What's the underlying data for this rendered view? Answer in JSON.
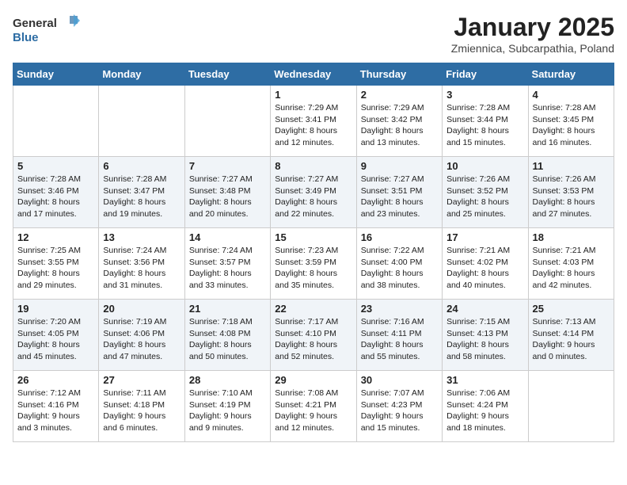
{
  "header": {
    "logo_general": "General",
    "logo_blue": "Blue",
    "main_title": "January 2025",
    "subtitle": "Zmiennica, Subcarpathia, Poland"
  },
  "days_of_week": [
    "Sunday",
    "Monday",
    "Tuesday",
    "Wednesday",
    "Thursday",
    "Friday",
    "Saturday"
  ],
  "weeks": [
    [
      {
        "day": "",
        "content": ""
      },
      {
        "day": "",
        "content": ""
      },
      {
        "day": "",
        "content": ""
      },
      {
        "day": "1",
        "content": "Sunrise: 7:29 AM\nSunset: 3:41 PM\nDaylight: 8 hours\nand 12 minutes."
      },
      {
        "day": "2",
        "content": "Sunrise: 7:29 AM\nSunset: 3:42 PM\nDaylight: 8 hours\nand 13 minutes."
      },
      {
        "day": "3",
        "content": "Sunrise: 7:28 AM\nSunset: 3:44 PM\nDaylight: 8 hours\nand 15 minutes."
      },
      {
        "day": "4",
        "content": "Sunrise: 7:28 AM\nSunset: 3:45 PM\nDaylight: 8 hours\nand 16 minutes."
      }
    ],
    [
      {
        "day": "5",
        "content": "Sunrise: 7:28 AM\nSunset: 3:46 PM\nDaylight: 8 hours\nand 17 minutes."
      },
      {
        "day": "6",
        "content": "Sunrise: 7:28 AM\nSunset: 3:47 PM\nDaylight: 8 hours\nand 19 minutes."
      },
      {
        "day": "7",
        "content": "Sunrise: 7:27 AM\nSunset: 3:48 PM\nDaylight: 8 hours\nand 20 minutes."
      },
      {
        "day": "8",
        "content": "Sunrise: 7:27 AM\nSunset: 3:49 PM\nDaylight: 8 hours\nand 22 minutes."
      },
      {
        "day": "9",
        "content": "Sunrise: 7:27 AM\nSunset: 3:51 PM\nDaylight: 8 hours\nand 23 minutes."
      },
      {
        "day": "10",
        "content": "Sunrise: 7:26 AM\nSunset: 3:52 PM\nDaylight: 8 hours\nand 25 minutes."
      },
      {
        "day": "11",
        "content": "Sunrise: 7:26 AM\nSunset: 3:53 PM\nDaylight: 8 hours\nand 27 minutes."
      }
    ],
    [
      {
        "day": "12",
        "content": "Sunrise: 7:25 AM\nSunset: 3:55 PM\nDaylight: 8 hours\nand 29 minutes."
      },
      {
        "day": "13",
        "content": "Sunrise: 7:24 AM\nSunset: 3:56 PM\nDaylight: 8 hours\nand 31 minutes."
      },
      {
        "day": "14",
        "content": "Sunrise: 7:24 AM\nSunset: 3:57 PM\nDaylight: 8 hours\nand 33 minutes."
      },
      {
        "day": "15",
        "content": "Sunrise: 7:23 AM\nSunset: 3:59 PM\nDaylight: 8 hours\nand 35 minutes."
      },
      {
        "day": "16",
        "content": "Sunrise: 7:22 AM\nSunset: 4:00 PM\nDaylight: 8 hours\nand 38 minutes."
      },
      {
        "day": "17",
        "content": "Sunrise: 7:21 AM\nSunset: 4:02 PM\nDaylight: 8 hours\nand 40 minutes."
      },
      {
        "day": "18",
        "content": "Sunrise: 7:21 AM\nSunset: 4:03 PM\nDaylight: 8 hours\nand 42 minutes."
      }
    ],
    [
      {
        "day": "19",
        "content": "Sunrise: 7:20 AM\nSunset: 4:05 PM\nDaylight: 8 hours\nand 45 minutes."
      },
      {
        "day": "20",
        "content": "Sunrise: 7:19 AM\nSunset: 4:06 PM\nDaylight: 8 hours\nand 47 minutes."
      },
      {
        "day": "21",
        "content": "Sunrise: 7:18 AM\nSunset: 4:08 PM\nDaylight: 8 hours\nand 50 minutes."
      },
      {
        "day": "22",
        "content": "Sunrise: 7:17 AM\nSunset: 4:10 PM\nDaylight: 8 hours\nand 52 minutes."
      },
      {
        "day": "23",
        "content": "Sunrise: 7:16 AM\nSunset: 4:11 PM\nDaylight: 8 hours\nand 55 minutes."
      },
      {
        "day": "24",
        "content": "Sunrise: 7:15 AM\nSunset: 4:13 PM\nDaylight: 8 hours\nand 58 minutes."
      },
      {
        "day": "25",
        "content": "Sunrise: 7:13 AM\nSunset: 4:14 PM\nDaylight: 9 hours\nand 0 minutes."
      }
    ],
    [
      {
        "day": "26",
        "content": "Sunrise: 7:12 AM\nSunset: 4:16 PM\nDaylight: 9 hours\nand 3 minutes."
      },
      {
        "day": "27",
        "content": "Sunrise: 7:11 AM\nSunset: 4:18 PM\nDaylight: 9 hours\nand 6 minutes."
      },
      {
        "day": "28",
        "content": "Sunrise: 7:10 AM\nSunset: 4:19 PM\nDaylight: 9 hours\nand 9 minutes."
      },
      {
        "day": "29",
        "content": "Sunrise: 7:08 AM\nSunset: 4:21 PM\nDaylight: 9 hours\nand 12 minutes."
      },
      {
        "day": "30",
        "content": "Sunrise: 7:07 AM\nSunset: 4:23 PM\nDaylight: 9 hours\nand 15 minutes."
      },
      {
        "day": "31",
        "content": "Sunrise: 7:06 AM\nSunset: 4:24 PM\nDaylight: 9 hours\nand 18 minutes."
      },
      {
        "day": "",
        "content": ""
      }
    ]
  ]
}
